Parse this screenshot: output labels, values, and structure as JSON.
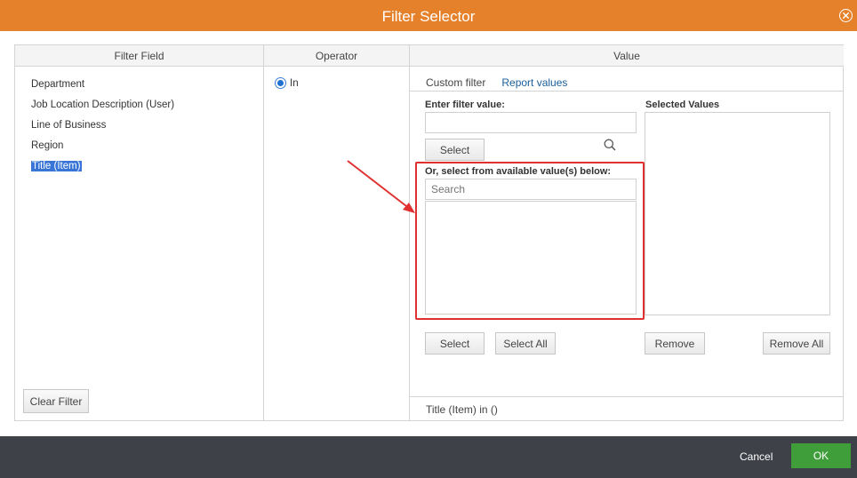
{
  "dialog": {
    "title": "Filter Selector",
    "close_icon": "close-circle-icon"
  },
  "columns": {
    "filter_field": "Filter Field",
    "operator": "Operator",
    "value": "Value"
  },
  "filter_fields": [
    {
      "label": "Department",
      "selected": false
    },
    {
      "label": "Job Location Description (User)",
      "selected": false
    },
    {
      "label": "Line of Business",
      "selected": false
    },
    {
      "label": "Region",
      "selected": false
    },
    {
      "label": "Title (Item)",
      "selected": true
    }
  ],
  "clear_filter_label": "Clear Filter",
  "operator": {
    "label": "In",
    "selected": true
  },
  "value_tabs": [
    {
      "label": "Custom filter",
      "active": false
    },
    {
      "label": "Report values",
      "active": true
    }
  ],
  "enter_filter": {
    "label": "Enter filter value:",
    "value": "",
    "select_label": "Select"
  },
  "available": {
    "label": "Or, select from available value(s) below:",
    "search_placeholder": "Search",
    "search_icon": "search-icon",
    "items": []
  },
  "selected_values": {
    "label": "Selected Values",
    "items": []
  },
  "buttons": {
    "select": "Select",
    "select_all": "Select All",
    "remove": "Remove",
    "remove_all": "Remove All"
  },
  "filter_expression": "Title (Item) in ()",
  "footer": {
    "cancel_label": "Cancel",
    "ok_label": "OK"
  },
  "colors": {
    "title_bar": "#e5812b",
    "footer_bar": "#3e4148",
    "ok_button": "#3f9d3a",
    "active_tab": "#1a5e9a",
    "selection": "#3875d7",
    "annotation": "#e03030"
  }
}
